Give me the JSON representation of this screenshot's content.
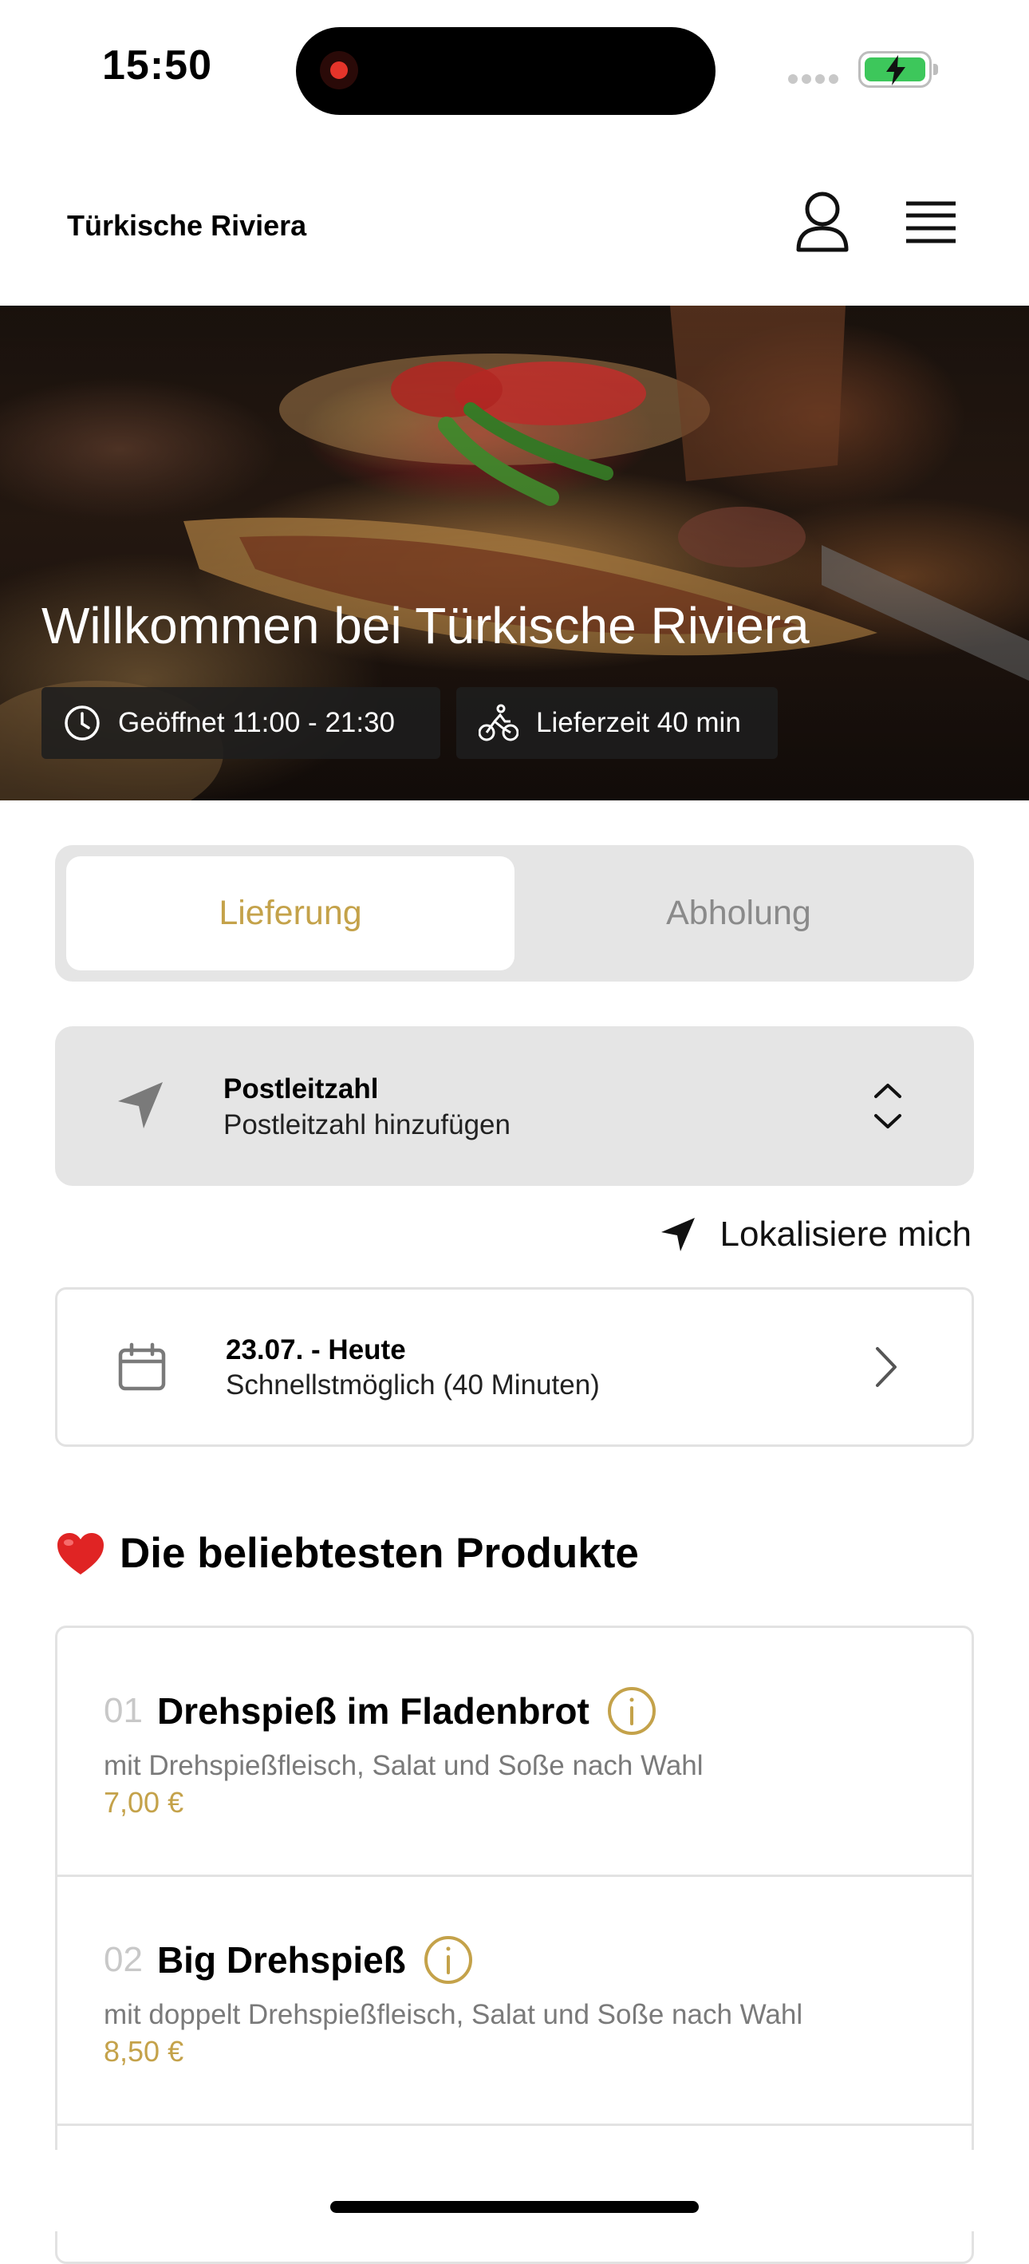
{
  "status_bar": {
    "time": "15:50"
  },
  "header": {
    "title": "Türkische Riviera",
    "profile_icon": "person-icon",
    "menu_icon": "hamburger-icon"
  },
  "hero": {
    "title": "Willkommen bei Türkische Riviera",
    "opening_hours": "Geöffnet 11:00 - 21:30",
    "delivery_time": "Lieferzeit 40 min"
  },
  "order_mode": {
    "options": [
      "Lieferung",
      "Abholung"
    ],
    "selected": "Lieferung"
  },
  "postcode": {
    "label": "Postleitzahl",
    "placeholder": "Postleitzahl hinzufügen"
  },
  "locate": {
    "label": "Lokalisiere mich"
  },
  "date": {
    "title": "23.07. - Heute",
    "subtitle": "Schnellstmöglich (40 Minuten)"
  },
  "popular": {
    "heading": "Die beliebtesten Produkte",
    "items": [
      {
        "number": "01",
        "name": "Drehspieß im Fladenbrot",
        "description": "mit Drehspießfleisch, Salat und Soße nach Wahl",
        "price": "7,00 €"
      },
      {
        "number": "02",
        "name": "Big Drehspieß",
        "description": "mit doppelt Drehspießfleisch, Salat und Soße nach Wahl",
        "price": "8,50 €"
      }
    ]
  },
  "colors": {
    "accent": "#c4a24a",
    "panel": "#e5e5e5",
    "battery": "#3dc75b"
  }
}
